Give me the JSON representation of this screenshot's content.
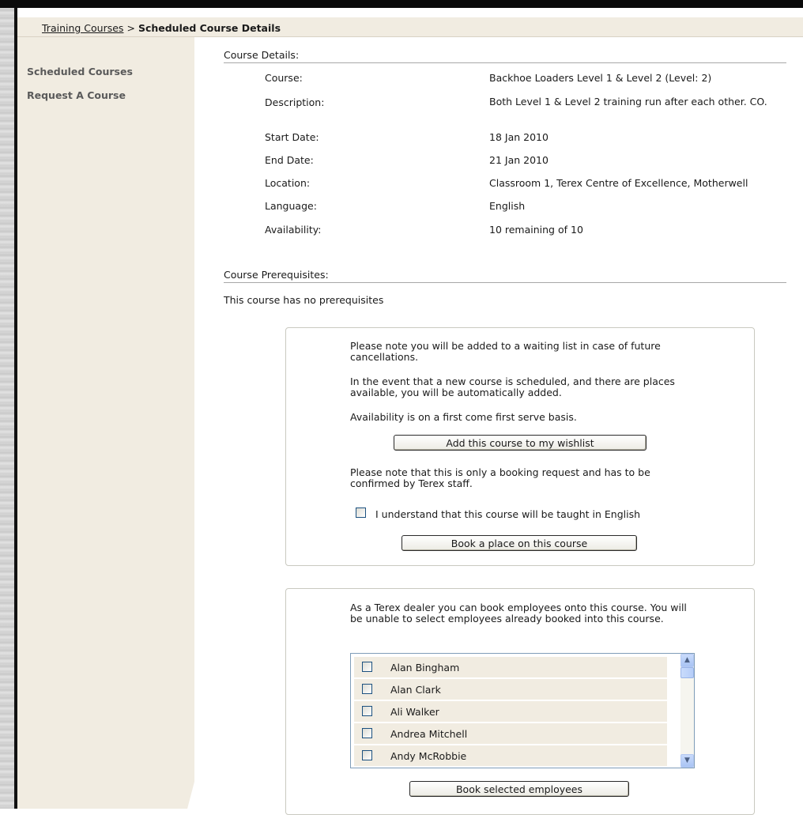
{
  "breadcrumb": {
    "link": "Training Courses",
    "separator": ">",
    "current": "Scheduled Course Details"
  },
  "sidebar": {
    "items": [
      {
        "label": "Scheduled Courses"
      },
      {
        "label": "Request A Course"
      }
    ]
  },
  "course_details": {
    "heading": "Course Details:",
    "rows": [
      {
        "label": "Course:",
        "value": "Backhoe Loaders Level 1 & Level 2 (Level: 2)"
      },
      {
        "label": "Description:",
        "value": "Both Level 1 & Level 2 training run after each other. CO."
      },
      {
        "label": "Start Date:",
        "value": "18 Jan 2010"
      },
      {
        "label": "End Date:",
        "value": "21 Jan 2010"
      },
      {
        "label": "Location:",
        "value": "Classroom 1, Terex Centre of Excellence, Motherwell"
      },
      {
        "label": "Language:",
        "value": "English"
      },
      {
        "label": "Availability:",
        "value": "10 remaining of 10"
      }
    ]
  },
  "prerequisites": {
    "heading": "Course Prerequisites:",
    "text": "This course has no prerequisites"
  },
  "booking_panel": {
    "waiting_note": "Please note you will be added to a waiting list in case of future cancellations.",
    "new_course_note": "In the event that a new course is scheduled, and there are places available, you will be automatically added.",
    "availability_note": "Availability is on a first come first serve basis.",
    "wishlist_button": "Add this course to my wishlist",
    "booking_note": "Please note that this is only a booking request and has to be confirmed by Terex staff.",
    "language_checkbox_label": "I understand that this course will be taught in English",
    "language_checked": false,
    "book_button": "Book a place on this course"
  },
  "dealer_panel": {
    "note": "As a Terex dealer you can book employees onto this course. You will be unable to select employees already booked into this course.",
    "employees": [
      {
        "name": "Alan Bingham",
        "checked": false
      },
      {
        "name": "Alan Clark",
        "checked": false
      },
      {
        "name": "Ali Walker",
        "checked": false
      },
      {
        "name": "Andrea Mitchell",
        "checked": false
      },
      {
        "name": "Andy McRobbie",
        "checked": false
      }
    ],
    "book_button": "Book selected employees"
  }
}
